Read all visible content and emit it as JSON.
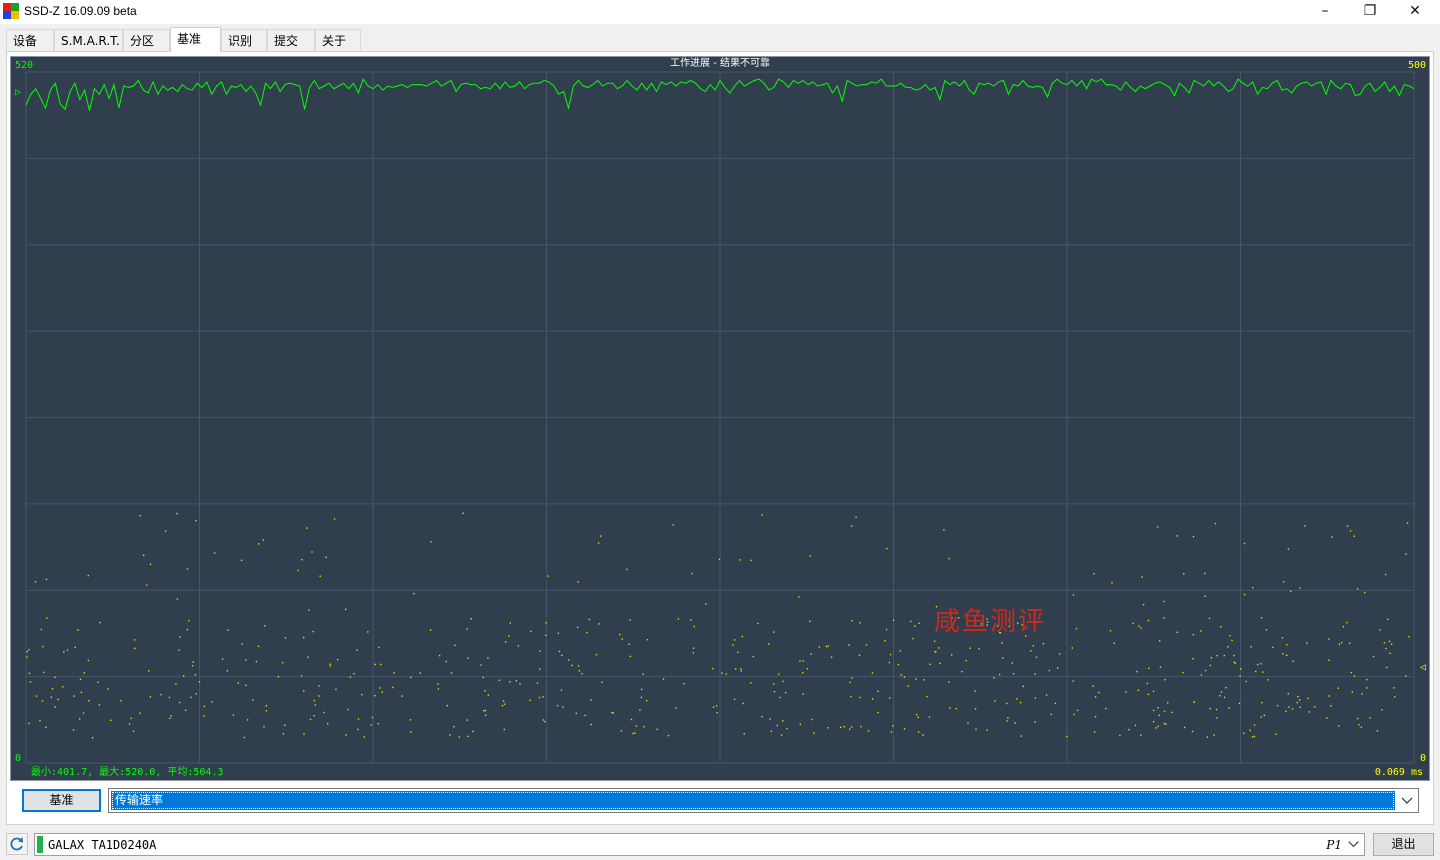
{
  "window": {
    "title": "SSD-Z 16.09.09 beta",
    "minimize": "–",
    "maximize": "❐",
    "close": "✕"
  },
  "tabs": [
    "设备",
    "S.M.A.R.T.",
    "分区",
    "基准",
    "识别",
    "提交",
    "关于"
  ],
  "active_tab": 3,
  "graph": {
    "title": "工作进展  -  结果不可靠",
    "left_top": "520",
    "left_bottom": "0",
    "right_top": "500",
    "right_bottom": "0",
    "stats": "最小:401.7, 最大:520.0, 平均:504.3",
    "latency": "0.069 ms",
    "watermark": "咸鱼测评",
    "marker_left": "▷",
    "marker_right": "◁"
  },
  "chart_data": {
    "type": "line",
    "left_axis_range": [
      0,
      520
    ],
    "right_axis_range": [
      0,
      500
    ],
    "grid": true,
    "series": [
      {
        "values": [
          498,
          506,
          510,
          503,
          496,
          509,
          514,
          499,
          495,
          508,
          514,
          502,
          509,
          494,
          510,
          506,
          513,
          503,
          513,
          496,
          512,
          511,
          512,
          516,
          509,
          507,
          515,
          506,
          512,
          509,
          511,
          508,
          513,
          510,
          509,
          514,
          511,
          515,
          506,
          512,
          515,
          506,
          512,
          511,
          513,
          508,
          512,
          507,
          498,
          514,
          510,
          515,
          508,
          513,
          514,
          513,
          512,
          495,
          511,
          516,
          510,
          512,
          514,
          510,
          512,
          514,
          510,
          514,
          507,
          517,
          512,
          510,
          513,
          509,
          512,
          511,
          512,
          513,
          511,
          513,
          513,
          513,
          512,
          514,
          516,
          512,
          514,
          516,
          508,
          513,
          514,
          513,
          513,
          510,
          511,
          510,
          514,
          510,
          515,
          511,
          512,
          515,
          510,
          513,
          514,
          514,
          516,
          515,
          512,
          506,
          508,
          496,
          512,
          516,
          512,
          511,
          513,
          516,
          512,
          514,
          514,
          510,
          512,
          516,
          512,
          509,
          514,
          509,
          514,
          508,
          515,
          513,
          515,
          512,
          515,
          514,
          516,
          514,
          510,
          508,
          513,
          509,
          516,
          511,
          507,
          512,
          516,
          512,
          514,
          516,
          517,
          514,
          509,
          511,
          517,
          515,
          511,
          516,
          514,
          516,
          513,
          515,
          512,
          513,
          514,
          507,
          512,
          501,
          516,
          514,
          512,
          513,
          513,
          515,
          514,
          517,
          512,
          512,
          512,
          514,
          511,
          511,
          509,
          510,
          513,
          509,
          511,
          502,
          516,
          513,
          515,
          512,
          516,
          509,
          506,
          514,
          513,
          514,
          512,
          515,
          516,
          506,
          513,
          512,
          516,
          512,
          511,
          512,
          511,
          504,
          514,
          517,
          514,
          513,
          516,
          512,
          516,
          510,
          517,
          515,
          517,
          513,
          513,
          512,
          509,
          515,
          511,
          508,
          512,
          510,
          512,
          514,
          515,
          513,
          511,
          505,
          514,
          511,
          507,
          516,
          514,
          512,
          516,
          512,
          515,
          512,
          508,
          510,
          517,
          514,
          512,
          515,
          506,
          511,
          510,
          514,
          516,
          509,
          510,
          507,
          512,
          514,
          515,
          512,
          514,
          515,
          506,
          516,
          512,
          510,
          514,
          513,
          505,
          506,
          512,
          514,
          508,
          511,
          515,
          508,
          512,
          505,
          513,
          512,
          510
        ]
      }
    ]
  },
  "controls": {
    "benchmark_button": "基准",
    "mode_select": "传输速率"
  },
  "status": {
    "drive": "GALAX TA1D0240A",
    "partition": "P1",
    "exit_button": "退出"
  },
  "colors": {
    "graph_bg": "#313e4e",
    "grid": "#45566a",
    "line": "#00ff00",
    "scatter": "#dddd00",
    "axis_text_left": "#00ff00",
    "axis_text_right": "#ffff00",
    "title_text": "#ffffff",
    "watermark": "#cc2a1e"
  }
}
